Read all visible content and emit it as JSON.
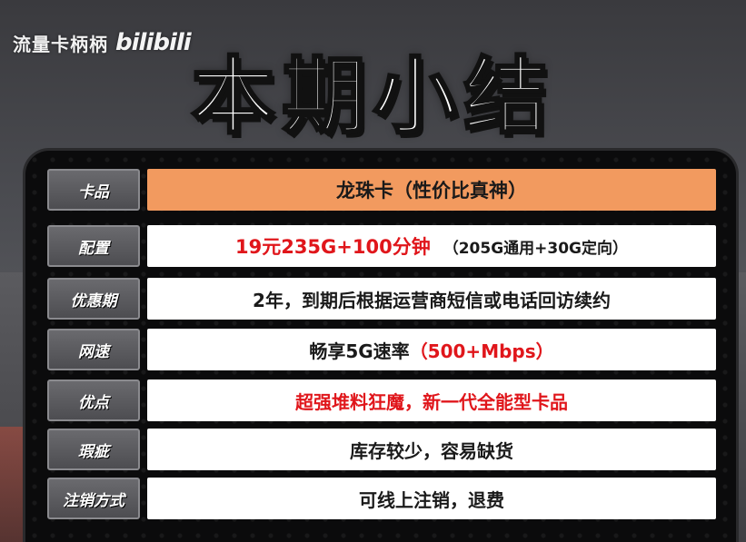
{
  "watermark": {
    "channel": "流量卡柄柄",
    "logo": "bilibili"
  },
  "title": "本期小结",
  "rows": [
    {
      "label": "卡品",
      "value": "龙珠卡（性价比真神）"
    },
    {
      "label": "配置",
      "value_red": "19元235G+100分钟",
      "value_note": "（205G通用+30G定向）"
    },
    {
      "label": "优惠期",
      "value": "2年，到期后根据运营商短信或电话回访续约"
    },
    {
      "label": "网速",
      "value_prefix": "畅享5G速率",
      "value_red": "（500+Mbps）"
    },
    {
      "label": "优点",
      "value_red": "超强堆料狂魔，新一代全能型卡品"
    },
    {
      "label": "瑕疵",
      "value": "库存较少，容易缺货"
    },
    {
      "label": "注销方式",
      "value": "可线上注销，退费"
    }
  ],
  "colors": {
    "highlight_row": "#f29a5f",
    "accent_red": "#e0161b",
    "panel": "#0b0b0c"
  }
}
